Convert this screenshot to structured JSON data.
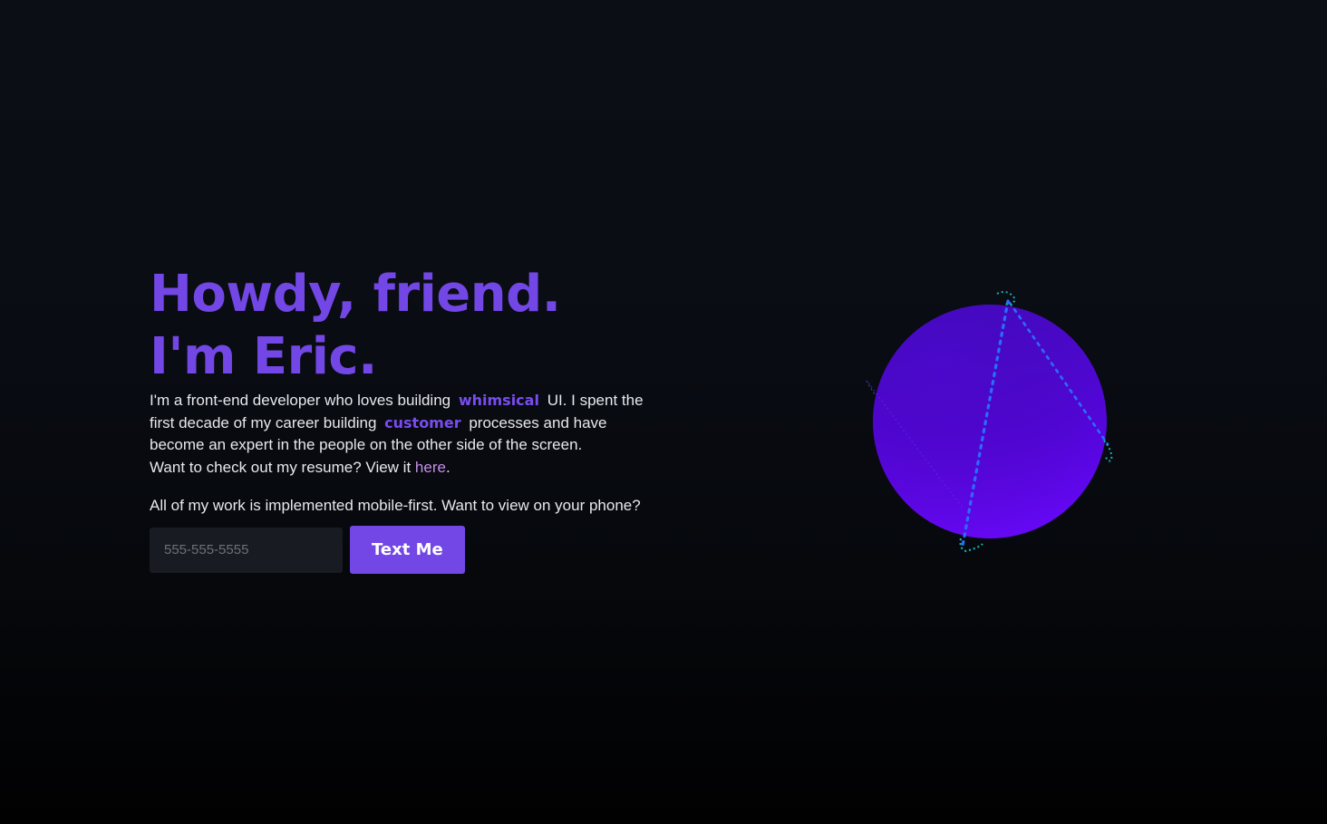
{
  "hero": {
    "headline_line1": "Howdy, friend.",
    "headline_line2": "I'm Eric.",
    "intro_part1": "I'm a front-end developer who loves building",
    "highlight_whimsical": "whimsical",
    "intro_part2": "UI. I spent the first decade of my career building",
    "highlight_customer": "customer",
    "intro_part3": "processes and have become an expert in the people on the other side of the screen.",
    "resume_prompt": "Want to check out my resume? View it",
    "resume_link_text": "here",
    "resume_suffix": ".",
    "mobile_note": "All of my work is implemented mobile-first. Want to view on your phone?"
  },
  "form": {
    "phone_placeholder": "555-555-5555",
    "phone_value": "",
    "submit_label": "Text Me"
  },
  "colors": {
    "accent": "#7347e6",
    "link": "#c58ee8",
    "orb_top": "#4e0ad8",
    "orb_bottom": "#6a08ff",
    "orbit_blue": "#2a6cff",
    "orbit_teal": "#18b3a8"
  },
  "decoration": {
    "orb_name": "orbiting-sphere-graphic"
  }
}
